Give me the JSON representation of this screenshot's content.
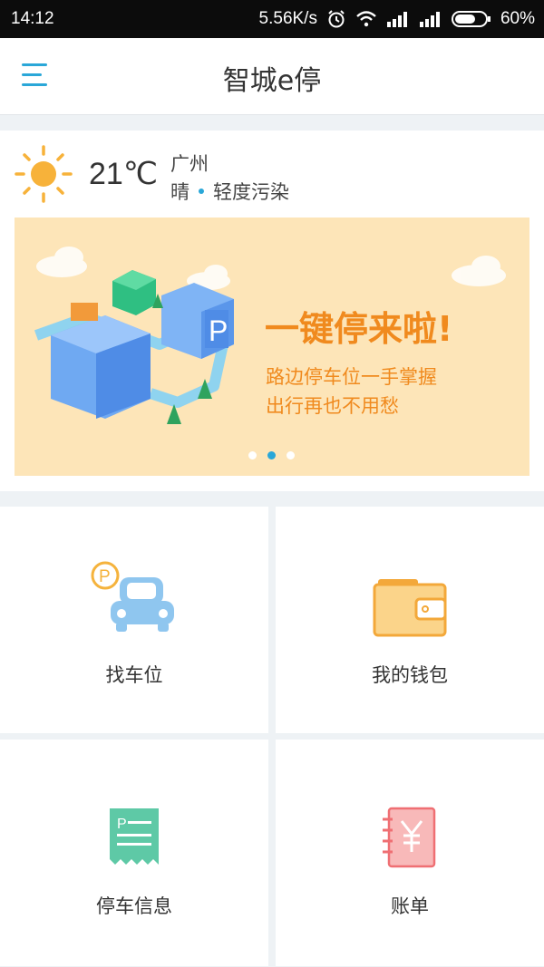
{
  "status_bar": {
    "time": "14:12",
    "network_speed": "5.56K/s",
    "battery": "60%"
  },
  "app_bar": {
    "title": "智城e停"
  },
  "weather": {
    "temperature": "21℃",
    "city": "广州",
    "condition": "晴",
    "air_quality": "轻度污染"
  },
  "banner": {
    "title": "一键停来啦!",
    "line1": "路边停车位一手掌握",
    "line2": "出行再也不用愁",
    "slide_count": 3,
    "active_slide": 2
  },
  "tiles": [
    {
      "label": "找车位",
      "icon": "car-parking-icon"
    },
    {
      "label": "我的钱包",
      "icon": "wallet-icon"
    },
    {
      "label": "停车信息",
      "icon": "receipt-icon"
    },
    {
      "label": "账单",
      "icon": "yen-notebook-icon"
    }
  ],
  "colors": {
    "accent": "#2aa7d8",
    "orange": "#f08a1e",
    "banner_bg": "#fde5b8"
  }
}
